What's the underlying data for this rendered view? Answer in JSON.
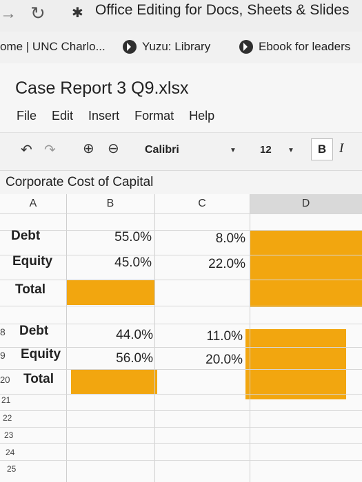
{
  "browser": {
    "tab_title": "Office Editing for Docs, Sheets & Slides",
    "bookmarks": [
      {
        "label": "ome | UNC Charlo..."
      },
      {
        "label": "Yuzu: Library"
      },
      {
        "label": "Ebook for leaders"
      }
    ]
  },
  "document": {
    "title": "Case Report 3 Q9.xlsx",
    "menu": [
      "File",
      "Edit",
      "Insert",
      "Format",
      "Help"
    ]
  },
  "toolbar": {
    "font": "Calibri",
    "font_size": "12",
    "bold": "B",
    "italic": "I"
  },
  "sheet": {
    "title": "Corporate Cost of Capital",
    "columns": [
      "A",
      "B",
      "C",
      "D"
    ],
    "table1": [
      {
        "label": "Debt",
        "b": "55.0%",
        "c": "8.0%"
      },
      {
        "label": "Equity",
        "b": "45.0%",
        "c": "22.0%"
      },
      {
        "label": "Total",
        "b": "",
        "c": ""
      }
    ],
    "table2": [
      {
        "row": "8",
        "label": "Debt",
        "b": "44.0%",
        "c": "11.0%"
      },
      {
        "row": "9",
        "label": "Equity",
        "b": "56.0%",
        "c": "20.0%"
      },
      {
        "row": "20",
        "label": "Total",
        "b": "",
        "c": ""
      }
    ],
    "row_numbers": [
      "21",
      "22",
      "23",
      "24",
      "25"
    ],
    "highlight_color": "#f2a60f"
  }
}
